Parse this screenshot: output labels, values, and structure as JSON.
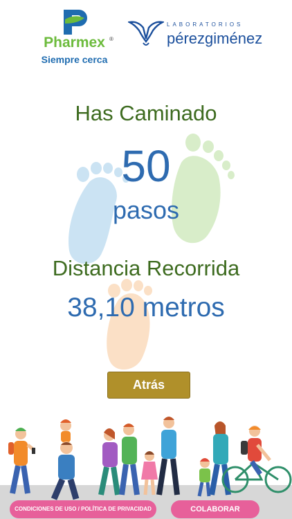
{
  "header": {
    "pharmex": {
      "name": "Pharmex",
      "registered": "®",
      "tagline": "Siempre cerca"
    },
    "laboratorios": {
      "label": "LABORATORIOS",
      "name": "pérezgiménez"
    }
  },
  "main": {
    "title_walked": "Has Caminado",
    "steps_count": "50",
    "steps_unit": "pasos",
    "title_distance": "Distancia Recorrida",
    "distance_value": "38,10 metros"
  },
  "actions": {
    "back_label": "Atrás"
  },
  "footer": {
    "conditions_label": "CONDICIONES DE USO / POLÍTICA DE PRIVACIDAD",
    "collaborate_label": "COLABORAR"
  },
  "colors": {
    "green_text": "#3d6b1f",
    "blue_text": "#2e6bb0",
    "button_gold": "#b0902a",
    "pink_button": "#e7609a"
  },
  "icons": {
    "footprints": [
      "footprint-blue-icon",
      "footprint-green-icon",
      "footprint-orange-icon"
    ],
    "illustration": "walking-people-illustration"
  }
}
